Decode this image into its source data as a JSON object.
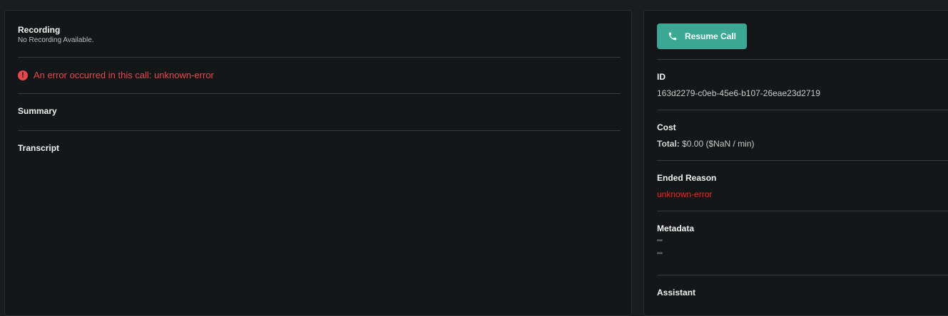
{
  "left": {
    "recording_title": "Recording",
    "recording_subtitle": "No Recording Available.",
    "error_text": "An error occurred in this call: unknown-error",
    "summary_title": "Summary",
    "transcript_title": "Transcript"
  },
  "right": {
    "resume_button": "Resume Call",
    "id_title": "ID",
    "id_value": "163d2279-c0eb-45e6-b107-26eae23d2719",
    "cost_title": "Cost",
    "cost_total_label": "Total:",
    "cost_total_value": "$0.00 ($NaN / min)",
    "ended_reason_title": "Ended Reason",
    "ended_reason_value": "unknown-error",
    "metadata_title": "Metadata",
    "metadata_lines": [
      "\"\"",
      "\"\""
    ],
    "assistant_title": "Assistant"
  },
  "colors": {
    "accent": "#3aa892",
    "error": "#e5484d",
    "ended_reason": "#ff1f1f",
    "panel_bg": "#141718"
  },
  "icons": {
    "error": "exclamation-circle-icon",
    "resume": "phone-icon"
  }
}
